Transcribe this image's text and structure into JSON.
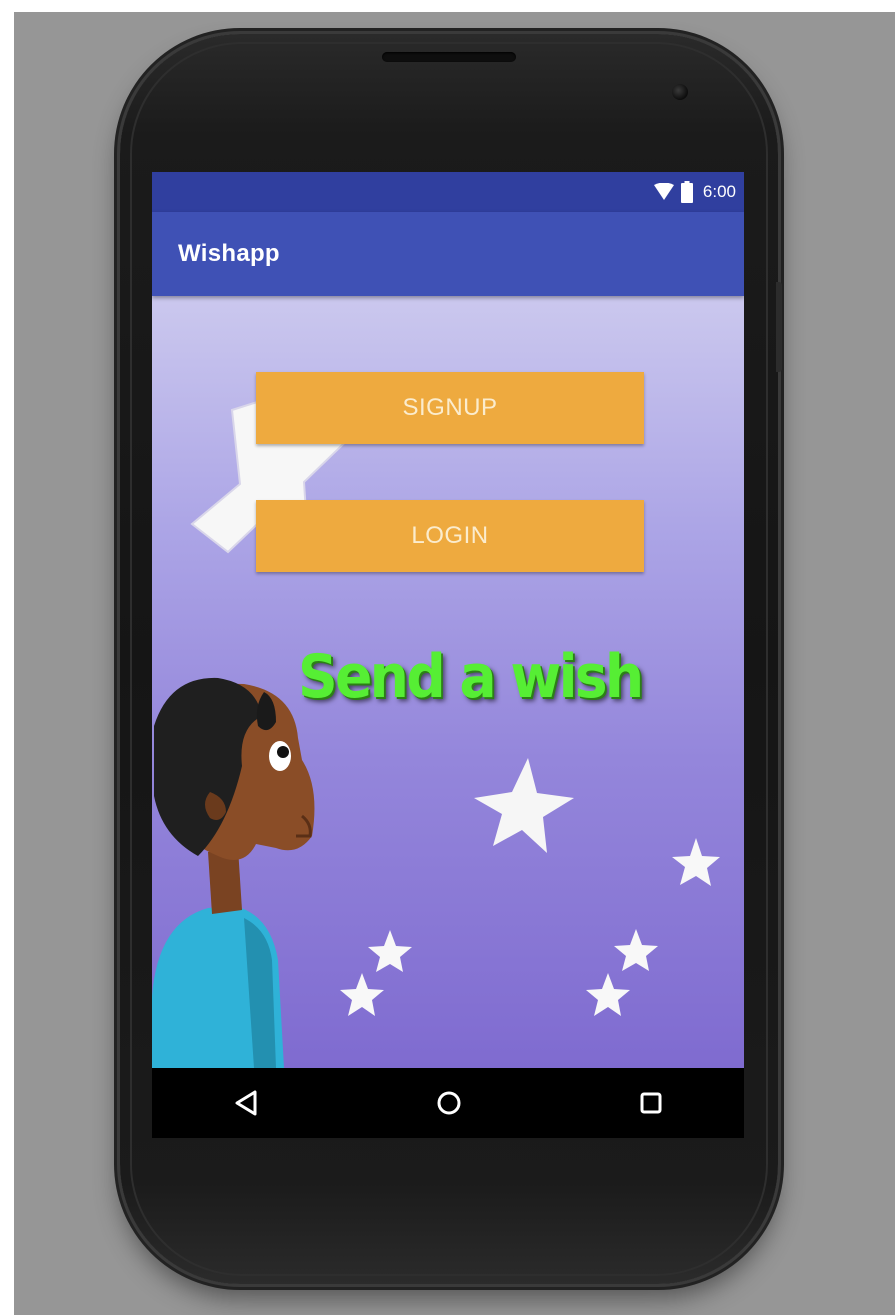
{
  "status_bar": {
    "time": "6:00",
    "icons": [
      "wifi-icon",
      "battery-icon"
    ]
  },
  "app_bar": {
    "title": "Wishapp"
  },
  "main": {
    "signup_label": "SIGNUP",
    "login_label": "LOGIN",
    "headline": "Send a wish"
  },
  "nav_bar": {
    "icons": [
      "back-icon",
      "home-icon",
      "recents-icon"
    ]
  },
  "colors": {
    "status_bar": "#303f9f",
    "app_bar": "#3f51b5",
    "button": "#eeaa3f",
    "headline": "#56ee34",
    "background_top": "#cbc8ee",
    "background_bottom": "#7f6bd0"
  }
}
